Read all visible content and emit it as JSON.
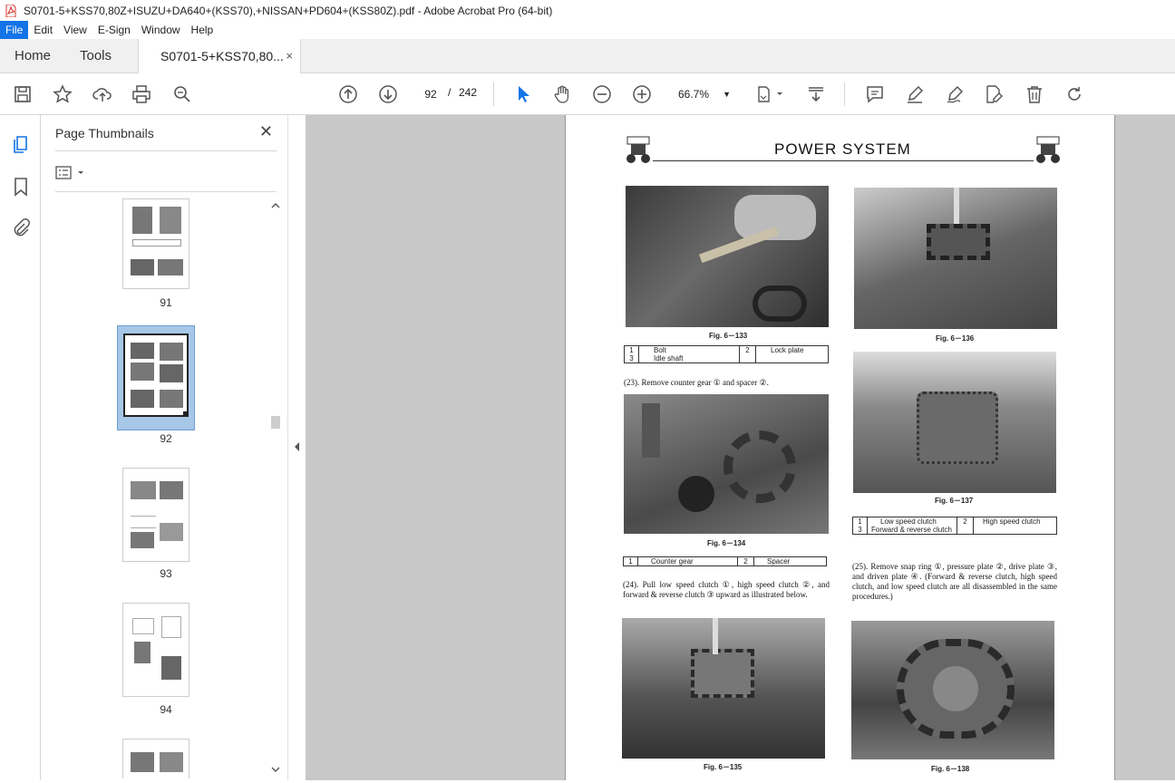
{
  "window": {
    "title": "S0701-5+KSS70,80Z+ISUZU+DA640+(KSS70),+NISSAN+PD604+(KSS80Z).pdf - Adobe Acrobat Pro (64-bit)"
  },
  "menu": [
    "File",
    "Edit",
    "View",
    "E-Sign",
    "Window",
    "Help"
  ],
  "tabs": {
    "home": "Home",
    "tools": "Tools",
    "document": "S0701-5+KSS70,80...",
    "close_glyph": "×"
  },
  "toolbar": {
    "current_page": "92",
    "page_sep": "/",
    "total_pages": "242",
    "zoom": "66.7%"
  },
  "panel": {
    "title": "Page Thumbnails",
    "close_glyph": "✕",
    "thumbnails": [
      {
        "label": "91"
      },
      {
        "label": "92",
        "selected": true
      },
      {
        "label": "93"
      },
      {
        "label": "94"
      }
    ]
  },
  "document_page": {
    "header": "POWER SYSTEM",
    "fig133": "Fig. 6－133",
    "fig134": "Fig. 6－134",
    "fig135": "Fig. 6－135",
    "fig136": "Fig. 6－136",
    "fig137": "Fig. 6－137",
    "fig138": "Fig. 6－138",
    "t1": {
      "n1": "1",
      "l1": "Bolt",
      "n2": "2",
      "l2": "Lock plate",
      "n3": "3",
      "l3": "Idle shaft"
    },
    "t2": {
      "n1": "1",
      "l1": "Counter gear",
      "n2": "2",
      "l2": "Spacer"
    },
    "t3": {
      "n1": "1",
      "l1": "Low speed clutch",
      "n2": "2",
      "l2": "High speed clutch",
      "n3": "3",
      "l3": "Forward & reverse clutch"
    },
    "step23": "(23). Remove counter gear ① and spacer ②.",
    "step24": "(24). Pull low speed clutch ①, high speed clutch ②, and forward & reverse clutch ③ upward as illustrated below.",
    "step25": "(25). Remove snap ring ①, pressure plate ②, drive plate ③, and driven plate ④. (Forward & reverse clutch, high speed clutch, and low speed clutch are all disassembled in the same procedures.)"
  },
  "colors": {
    "accent": "#1473e6",
    "viewer_bg": "#c8c8c8",
    "thumb_selected": "#a7c7e7"
  }
}
